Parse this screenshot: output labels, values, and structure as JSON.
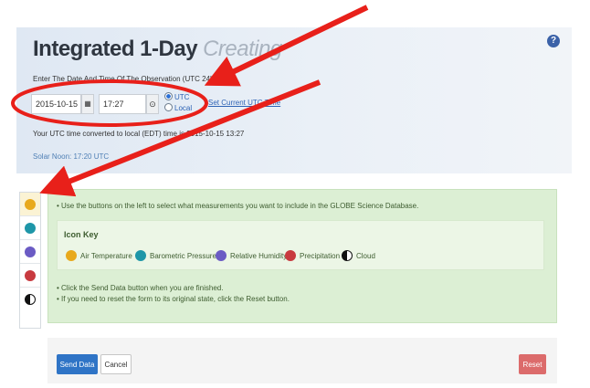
{
  "header": {
    "title": "Integrated 1-Day",
    "status": "Creating",
    "instruction": "Enter The Date And Time Of The Observation (UTC 24hr)",
    "date_value": "2015-10-15",
    "time_value": "17:27",
    "radio_utc": "UTC",
    "radio_local": "Local",
    "set_link": "Set Current UTC Time",
    "conversion": "Your UTC time converted to local (EDT) time is 2015-10-15 13:27",
    "solar_noon": "Solar Noon: 17:20 UTC",
    "help_glyph": "?"
  },
  "icons": {
    "help": "help-icon",
    "calendar": "calendar-icon",
    "clock": "clock-icon",
    "calendar_glyph": "▦",
    "clock_glyph": "⊙"
  },
  "sidebar": {
    "items": [
      {
        "name": "air-temperature",
        "icon": "air-temperature-icon",
        "color": "#e8a91c"
      },
      {
        "name": "barometric-pressure",
        "icon": "barometric-pressure-icon",
        "color": "#1e96a8"
      },
      {
        "name": "relative-humidity",
        "icon": "relative-humidity-icon",
        "color": "#6b5bc4"
      },
      {
        "name": "precipitation",
        "icon": "precipitation-icon",
        "color": "#c83a3f"
      },
      {
        "name": "cloud",
        "icon": "cloud-icon",
        "color": "#111111"
      }
    ]
  },
  "info": {
    "line1": "• Use the buttons on the left to select what measurements you want to include in the GLOBE Science Database.",
    "icon_key_title": "Icon Key",
    "keys": [
      "Air Temperature",
      "Barometric Pressure",
      "Relative Humidity",
      "Precipitation",
      "Cloud"
    ],
    "line2": "• Click the Send Data button when you are finished.",
    "line3": "• If you need to reset the form to its original state, click the Reset button."
  },
  "footer": {
    "send_label": "Send Data",
    "cancel_label": "Cancel",
    "reset_label": "Reset"
  },
  "colors": {
    "annotation": "#e8201a",
    "primary": "#2f74c6",
    "danger": "#dc6b6b",
    "success_bg": "#dcefd4",
    "header_bg": "#dfe8f3"
  }
}
